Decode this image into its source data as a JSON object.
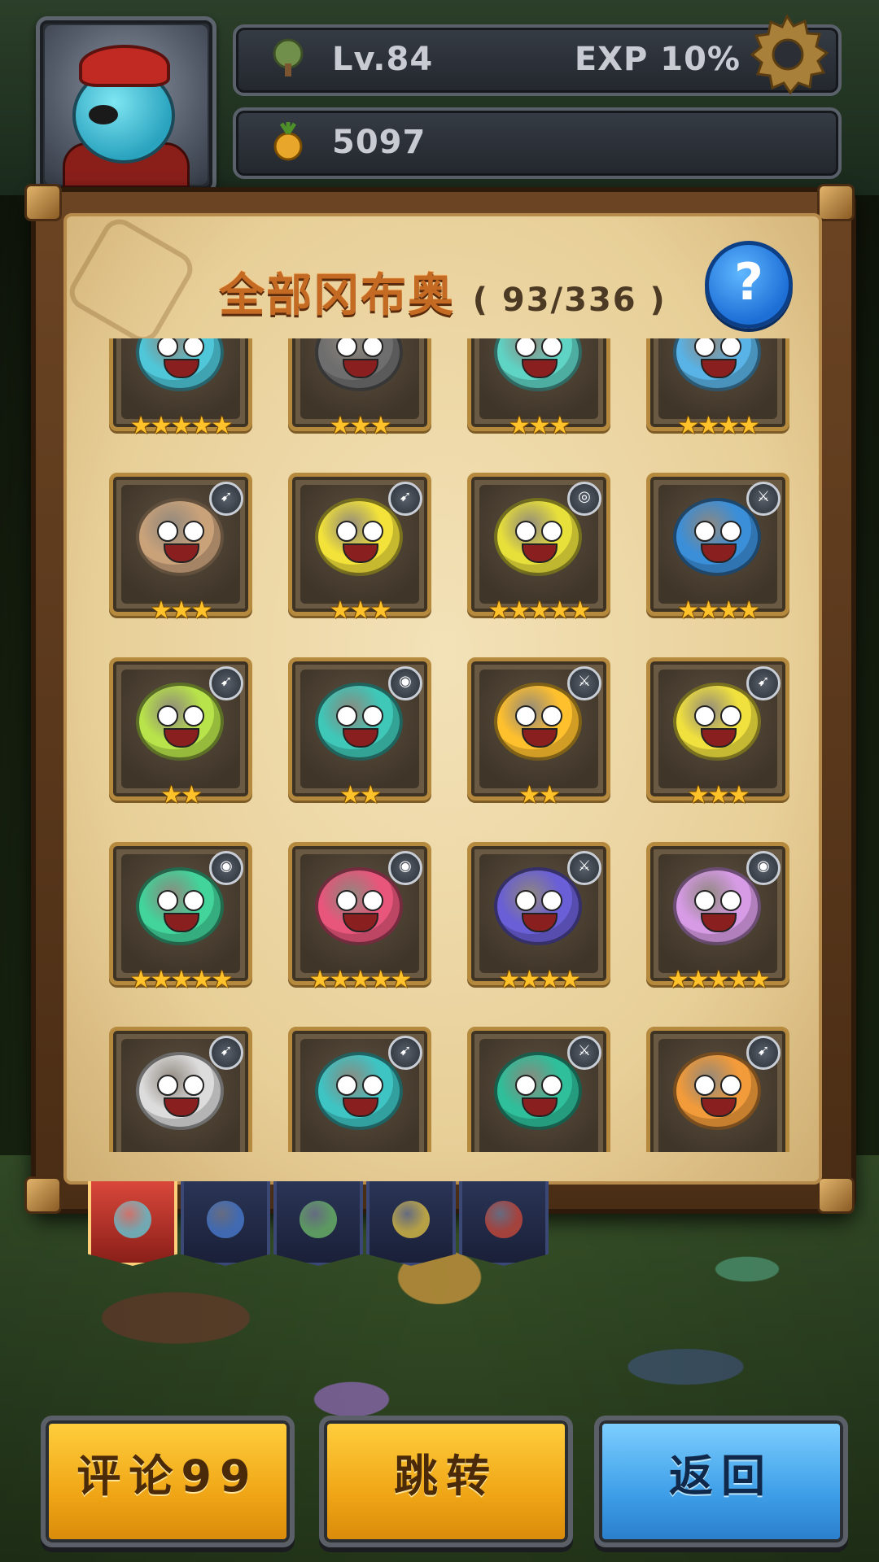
{
  "hud": {
    "level": "Lv.84",
    "exp": "EXP 10%",
    "fruit_count": "5097"
  },
  "collection": {
    "title": "全部冈布奥",
    "count": "( 93/336 )",
    "help": "?"
  },
  "cards": [
    {
      "color": "#4fc7d9",
      "element": "",
      "stars": "★★★★★",
      "partial": true
    },
    {
      "color": "#6e6e6e",
      "element": "",
      "stars": "★★★",
      "partial": true
    },
    {
      "color": "#5fd3c4",
      "element": "",
      "stars": "★★★",
      "partial": true
    },
    {
      "color": "#59b3e6",
      "element": "",
      "stars": "★★★★",
      "partial": true
    },
    {
      "color": "#c9a27a",
      "element": "➹",
      "stars": "★★★"
    },
    {
      "color": "#f2e23a",
      "element": "➹",
      "stars": "★★★"
    },
    {
      "color": "#e8e03a",
      "element": "◎",
      "stars": "★★★★★"
    },
    {
      "color": "#3b8fd9",
      "element": "⚔",
      "stars": "★★★★"
    },
    {
      "color": "#b8e34a",
      "element": "➹",
      "stars": "★★"
    },
    {
      "color": "#3fc7b8",
      "element": "◉",
      "stars": "★★"
    },
    {
      "color": "#ffc02e",
      "element": "⚔",
      "stars": "★★"
    },
    {
      "color": "#f1e13e",
      "element": "➹",
      "stars": "★★★"
    },
    {
      "color": "#42d49a",
      "element": "◉",
      "stars": "★★★★★"
    },
    {
      "color": "#e8567c",
      "element": "◉",
      "stars": "★★★★★"
    },
    {
      "color": "#6a5fd6",
      "element": "⚔",
      "stars": "★★★★"
    },
    {
      "color": "#d79be6",
      "element": "◉",
      "stars": "★★★★★"
    },
    {
      "color": "#dcdcdc",
      "element": "➹",
      "stars": "★★★★"
    },
    {
      "color": "#3fc4c4",
      "element": "➹",
      "stars": "★★★★★"
    },
    {
      "color": "#2fbf9a",
      "element": "⚔",
      "stars": "★★★★"
    },
    {
      "color": "#f29b3a",
      "element": "➹",
      "stars": "★★★★"
    }
  ],
  "tabs": [
    {
      "name": "all",
      "color": "#5fd0e0",
      "active": true
    },
    {
      "name": "blue",
      "color": "#4a7fd6",
      "active": false
    },
    {
      "name": "green",
      "color": "#6fbf6a",
      "active": false
    },
    {
      "name": "yellow",
      "color": "#e7c846",
      "active": false
    },
    {
      "name": "red",
      "color": "#d04a3a",
      "active": false
    }
  ],
  "buttons": {
    "comment": "评论99",
    "jump": "跳转",
    "back": "返回"
  },
  "colors": {
    "accent_yellow": "#f0a616",
    "accent_blue": "#3e9fe8",
    "title": "#c56a22"
  }
}
